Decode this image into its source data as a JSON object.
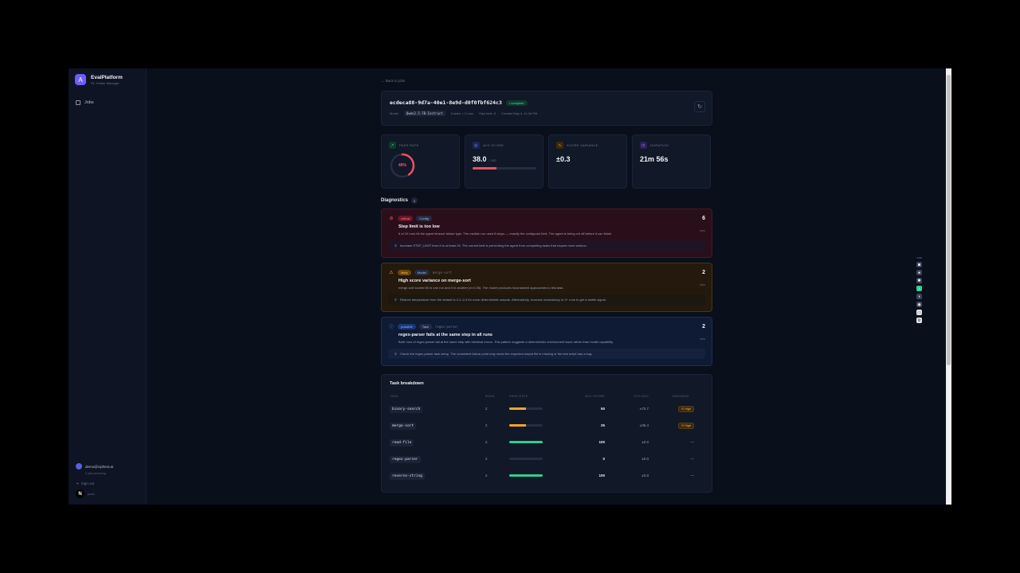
{
  "app": {
    "name": "EvalPlatform",
    "subtitle": "RL Trainer Manager"
  },
  "sidebar": {
    "nav": [
      {
        "label": "Jobs",
        "icon": "jobs-icon"
      }
    ],
    "user_email": "demo@ciphera.ai",
    "user_sub": "0 jobs remaining",
    "sign_out": "Sign out",
    "n_label": "pane"
  },
  "page": {
    "back_label": "← Back to jobs",
    "job_id": "ecdeca88-9d7a-40e1-8e9d-d0f0fbf624c3",
    "status": "• complete",
    "model_label": "Model",
    "model_value": "Qwen2.5-7B-Instruct",
    "tasks_runs": "5 tasks × 2 runs",
    "step_limit": "Step limit: 8",
    "created": "Created May 4, 11:06 PM"
  },
  "stats": {
    "pass_rate_label": "PASS RATE",
    "pass_rate_value": "40%",
    "pass_rate_fraction": 0.4,
    "avg_score_label": "AVG SCORE",
    "avg_score_value": "38.0",
    "avg_score_unit": "/ 100",
    "avg_score_fraction": 0.38,
    "variance_label": "SCORE VARIANCE",
    "variance_value": "±0.3",
    "duration_label": "DURATION",
    "duration_value": "21m 56s"
  },
  "diagnostics": {
    "title": "Diagnostics",
    "count": "3",
    "items": [
      {
        "severity": "critical",
        "category": "Config",
        "scope": "",
        "title": "Step limit is too low",
        "desc": "6 of 10 runs hit the agent timeout failure type. The median run used 8 steps — exactly the configured limit. The agent is being cut off before it can finish.",
        "fix": "Increase STEP_LIMIT from 8 to at least 25. The current limit is preventing the agent from completing tasks that require more actions.",
        "count": "6",
        "count_label": "runs",
        "color": "#ff5a6b"
      },
      {
        "severity": "likely",
        "category": "Model",
        "scope": "merge-sort",
        "title": "High score variance on merge-sort",
        "desc": "merge-sort scored 50 in one run and 0 in another (σ=0.35). The model produces inconsistent approaches to this task.",
        "fix": "Reduce temperature from the default to 0.2–0.3 for more deterministic outputs. Alternatively, increase redundancy to 3+ runs to get a stable signal.",
        "count": "2",
        "count_label": "runs",
        "color": "#ffb547"
      },
      {
        "severity": "possible",
        "category": "Task",
        "scope": "regex-parser",
        "title": "regex-parser fails at the same step in all runs",
        "desc": "Both runs of regex-parser fail at the same step with identical errors. This pattern suggests a deterministic environment issue rather than model capability.",
        "fix": "Check the regex-parser task setup. The consistent failure point may mean the expected output file is missing or the test script has a bug.",
        "count": "2",
        "count_label": "runs",
        "color": "#5b8cff"
      }
    ]
  },
  "tasks": {
    "title": "Task breakdown",
    "columns": [
      "TASK",
      "RUNS",
      "PASS RATE",
      "AVG SCORE",
      "STD DEV",
      "VARIANCE"
    ],
    "rows": [
      {
        "task": "binary-search",
        "runs": "2",
        "pass": 0.5,
        "bar_color": "#f5a623",
        "score": "50",
        "std": "±70.7",
        "variance": "⊙ High"
      },
      {
        "task": "merge-sort",
        "runs": "2",
        "pass": 0.5,
        "bar_color": "#f5a623",
        "score": "25",
        "std": "±35.4",
        "variance": "⊙ High"
      },
      {
        "task": "read-file",
        "runs": "2",
        "pass": 1.0,
        "bar_color": "#2fcf8f",
        "score": "100",
        "std": "±0.0",
        "variance": "—"
      },
      {
        "task": "regex-parser",
        "runs": "2",
        "pass": 0.0,
        "bar_color": "#2fcf8f",
        "score": "0",
        "std": "±0.0",
        "variance": "—"
      },
      {
        "task": "reverse-string",
        "runs": "2",
        "pass": 1.0,
        "bar_color": "#2fcf8f",
        "score": "100",
        "std": "±0.0",
        "variance": "—"
      }
    ]
  },
  "tools": {
    "time": "0:00"
  },
  "colors": {
    "accent": "#6d5dfc",
    "danger": "#ef4f5f",
    "success": "#2fcf8f",
    "warning": "#f5a623"
  }
}
